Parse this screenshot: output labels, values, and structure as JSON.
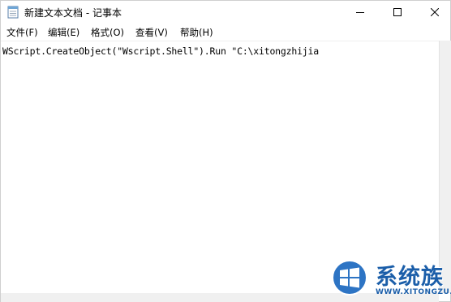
{
  "window": {
    "title": "新建文本文档 - 记事本"
  },
  "menu": {
    "file": "文件(F)",
    "edit": "编辑(E)",
    "format": "格式(O)",
    "view": "查看(V)",
    "help": "帮助(H)"
  },
  "editor": {
    "content": "WScript.CreateObject(\"Wscript.Shell\").Run \"C:\\xitongzhijia"
  },
  "watermark": {
    "brand": "系统族",
    "url": "WWW.XITONGZU.COM"
  },
  "icons": {
    "app": "notepad-icon",
    "minimize": "minimize-icon",
    "maximize": "maximize-icon",
    "close": "close-icon",
    "logo": "windows-logo-icon"
  },
  "colors": {
    "watermark_blue": "#1b5ea9"
  }
}
